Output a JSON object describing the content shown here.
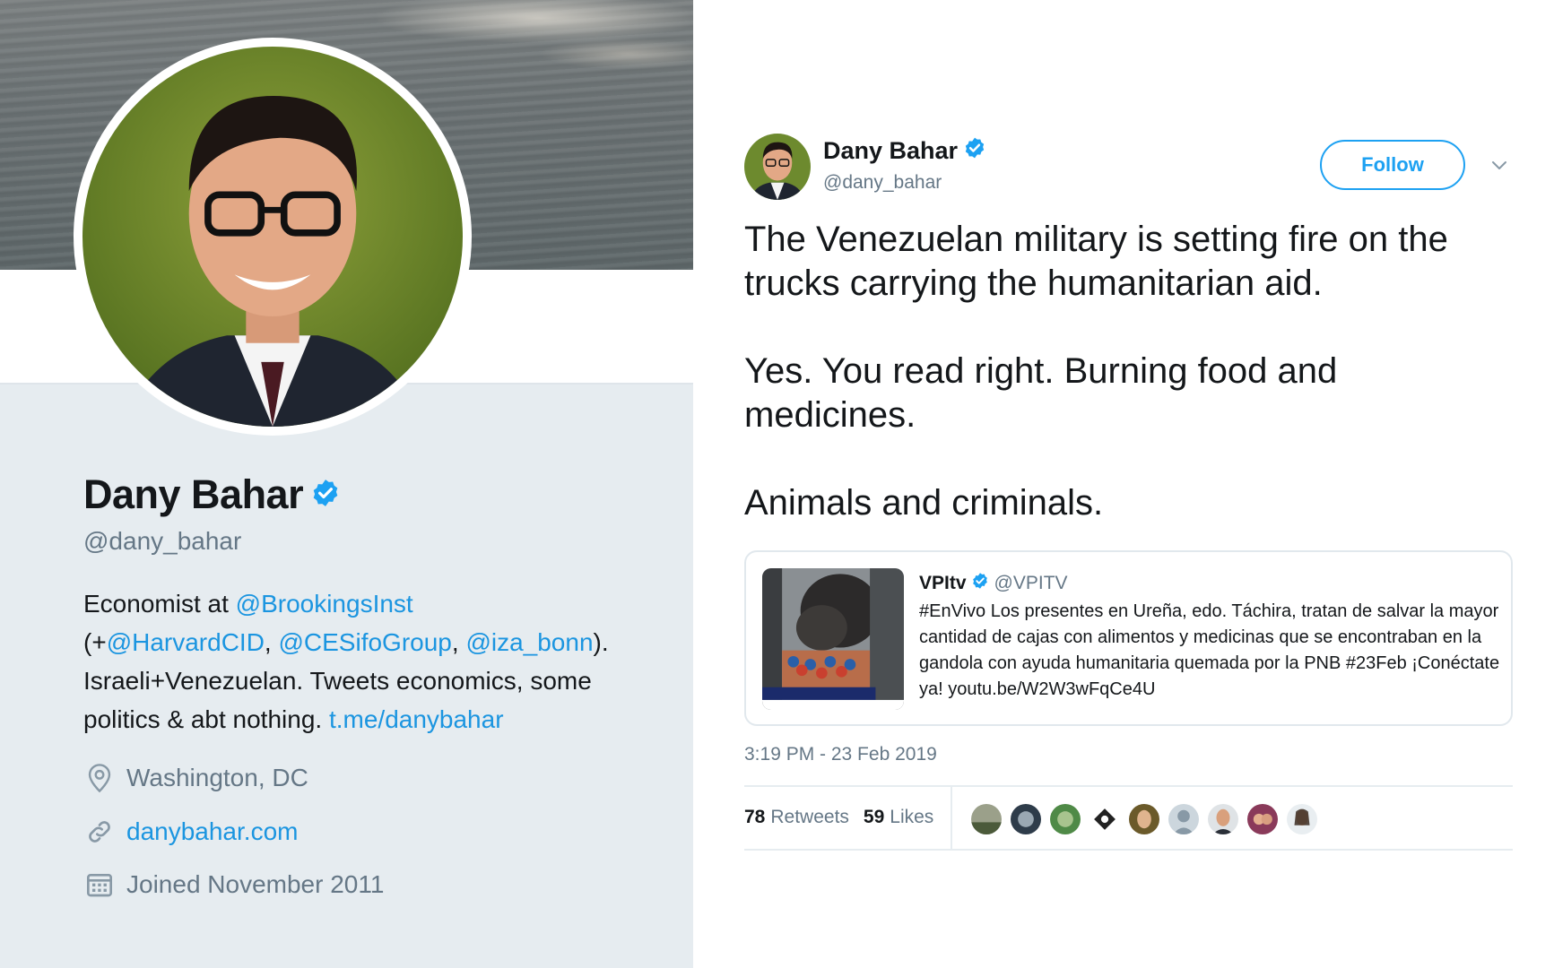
{
  "profile": {
    "name": "Dany Bahar",
    "handle": "@dany_bahar",
    "bio": {
      "p1": "Economist at ",
      "link_brookings": "@BrookingsInst",
      "p2": "(+",
      "link_harvard": "@HarvardCID",
      "sep1": ", ",
      "link_cesifo": "@CESifoGroup",
      "sep2": ", ",
      "link_iza": "@iza_bonn",
      "p3": ").",
      "p4": "Israeli+Venezuelan. Tweets economics, some politics & abt nothing. ",
      "link_telegram": "t.me/danybahar"
    },
    "location": "Washington, DC",
    "url": "danybahar.com",
    "joined": "Joined November 2011",
    "icons": {
      "location": "location-pin-icon",
      "url": "link-icon",
      "joined": "calendar-icon",
      "verified": "verified-badge-icon"
    }
  },
  "tweet": {
    "author_name": "Dany Bahar",
    "author_handle": "@dany_bahar",
    "follow_label": "Follow",
    "text": "The Venezuelan military is setting fire on the trucks carrying the humanitarian aid.\n\nYes. You read right. Burning food and medicines.\n\nAnimals and criminals.",
    "card": {
      "name": "VPItv",
      "handle": "@VPITV",
      "text": "#EnVivo Los presentes en Ureña, edo. Táchira, tratan de salvar la mayor cantidad de cajas con alimentos y medicinas que se encontraban en la gandola con ayuda humanitaria quemada por la PNB #23Feb ¡Conéctate ya! youtu.be/W2W3wFqCe4U"
    },
    "timestamp": "3:19 PM - 23 Feb 2019",
    "retweets_count": "78",
    "retweets_label": "Retweets",
    "likes_count": "59",
    "likes_label": "Likes"
  },
  "colors": {
    "link": "#1b95e0",
    "accent": "#1da1f2",
    "muted": "#657786",
    "panel": "#e6ecf0"
  }
}
